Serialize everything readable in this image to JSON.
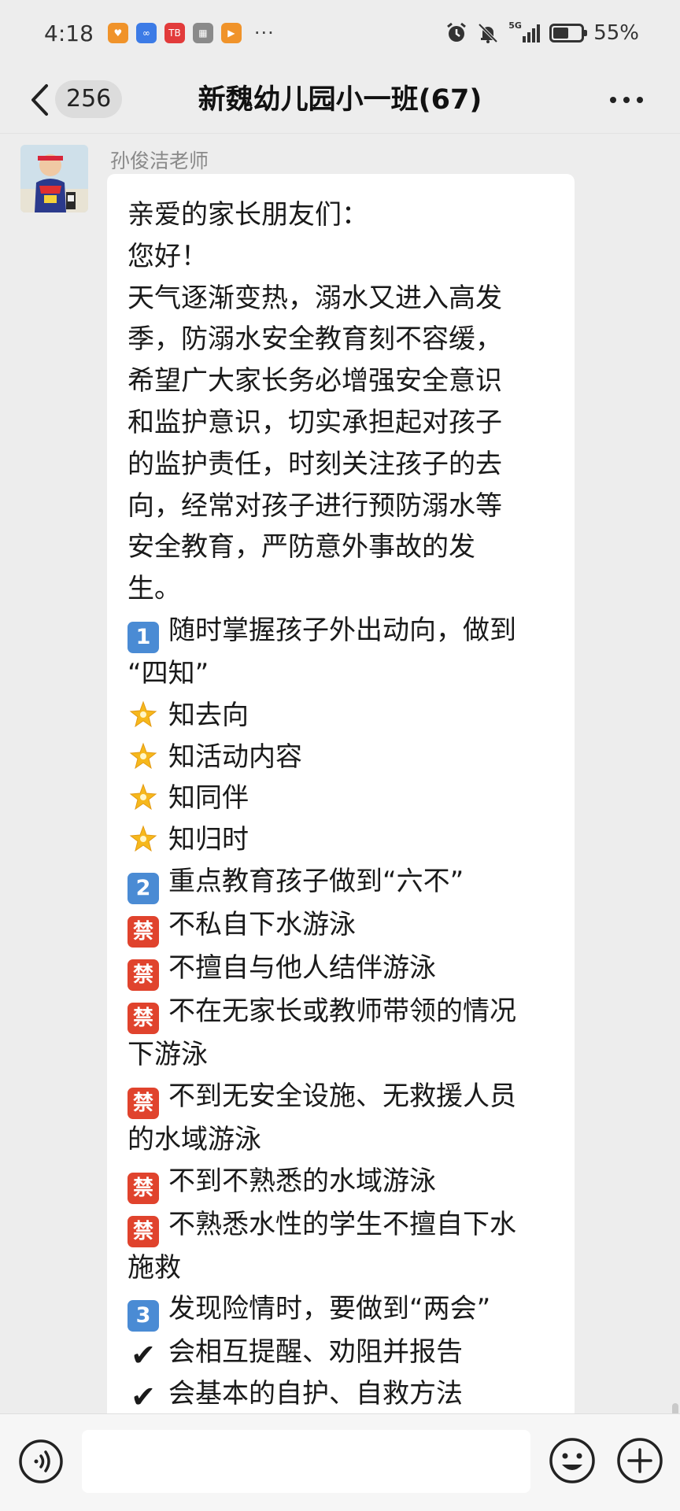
{
  "status_bar": {
    "time": "4:18",
    "app_icons": [
      {
        "name": "heart-app-icon",
        "color": "#f0932a",
        "glyph": "♥"
      },
      {
        "name": "cloud-app-icon",
        "color": "#3c7be6",
        "glyph": "∞"
      },
      {
        "name": "news-app-icon",
        "color": "#e23b3b",
        "glyph": "TB"
      },
      {
        "name": "gallery-app-icon",
        "color": "#8a8a8a",
        "glyph": "▦"
      },
      {
        "name": "video-app-icon",
        "color": "#f0932a",
        "glyph": "▶"
      }
    ],
    "more_dots": "···",
    "network_label": "5G",
    "battery_percent": "55%",
    "battery_level": 0.55
  },
  "nav": {
    "unread_count": "256",
    "title": "新魏幼儿园小一班(67)"
  },
  "message": {
    "sender": "孙俊洁老师",
    "lines": [
      {
        "emoji": "",
        "text": "亲爱的家长朋友们："
      },
      {
        "emoji": "",
        "text": "您好！"
      },
      {
        "emoji": "",
        "text": "天气逐渐变热，溺水又进入高发"
      },
      {
        "emoji": "",
        "text": "季，防溺水安全教育刻不容缓，"
      },
      {
        "emoji": "",
        "text": "希望广大家长务必增强安全意识"
      },
      {
        "emoji": "",
        "text": "和监护意识，切实承担起对孩子"
      },
      {
        "emoji": "",
        "text": "的监护责任，时刻关注孩子的去"
      },
      {
        "emoji": "",
        "text": "向，经常对孩子进行预防溺水等"
      },
      {
        "emoji": "",
        "text": "安全教育，严防意外事故的发"
      },
      {
        "emoji": "",
        "text": "生。"
      },
      {
        "emoji": "num",
        "badge": "1",
        "text": "随时掌握孩子外出动向，做到"
      },
      {
        "emoji": "",
        "text": "“四知”"
      },
      {
        "emoji": "star",
        "text": "知去向"
      },
      {
        "emoji": "star",
        "text": "知活动内容"
      },
      {
        "emoji": "star",
        "text": "知同伴"
      },
      {
        "emoji": "star",
        "text": "知归时"
      },
      {
        "emoji": "num",
        "badge": "2",
        "text": "重点教育孩子做到“六不”"
      },
      {
        "emoji": "ban",
        "badge": "禁",
        "text": "不私自下水游泳"
      },
      {
        "emoji": "ban",
        "badge": "禁",
        "text": "不擅自与他人结伴游泳"
      },
      {
        "emoji": "ban",
        "badge": "禁",
        "text": "不在无家长或教师带领的情况"
      },
      {
        "emoji": "",
        "text": "下游泳"
      },
      {
        "emoji": "ban",
        "badge": "禁",
        "text": "不到无安全设施、无救援人员"
      },
      {
        "emoji": "",
        "text": "的水域游泳"
      },
      {
        "emoji": "ban",
        "badge": "禁",
        "text": "不到不熟悉的水域游泳"
      },
      {
        "emoji": "ban",
        "badge": "禁",
        "text": "不熟悉水性的学生不擅自下水"
      },
      {
        "emoji": "",
        "text": "施救"
      },
      {
        "emoji": "num",
        "badge": "3",
        "text": "发现险情时，要做到“两会”"
      },
      {
        "emoji": "check",
        "badge": "✔",
        "text": "会相互提醒、劝阻并报告"
      },
      {
        "emoji": "check",
        "badge": "✔",
        "text": "会基本的自护、自救方法"
      }
    ]
  },
  "input_bar": {
    "placeholder": ""
  },
  "colors": {
    "background": "#ededed",
    "bubble": "#ffffff",
    "number_badge": "#4a8bd4",
    "ban_badge": "#e0432d",
    "star": "#f6b81c"
  }
}
